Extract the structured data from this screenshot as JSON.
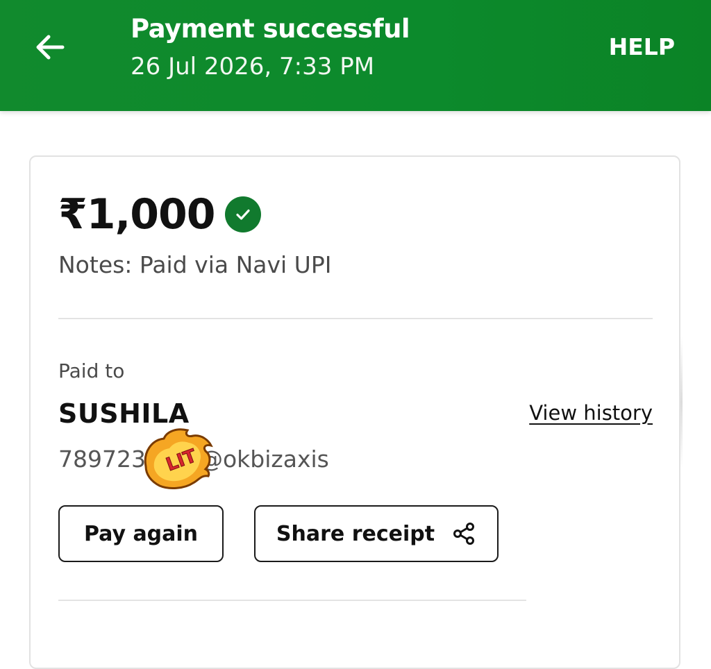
{
  "header": {
    "title": "Payment successful",
    "subtitle": "26 Jul 2026, 7:33 PM",
    "help_label": "HELP",
    "back_icon": "arrow-left-icon",
    "background_color": "#0e8a2d"
  },
  "payment": {
    "amount": "₹1,000",
    "status_icon": "check-circle-icon",
    "status_color": "#117a2e",
    "notes": "Notes: Paid via Navi UPI"
  },
  "payee": {
    "label": "Paid to",
    "name": "SUSHILA",
    "upi_prefix": "789723",
    "upi_suffix": "@okbizaxis",
    "view_history_label": "View history",
    "sticker_text": "LIT",
    "sticker_icon": "fire-sticker-icon"
  },
  "actions": {
    "pay_again_label": "Pay again",
    "share_receipt_label": "Share receipt",
    "share_icon": "share-icon"
  }
}
